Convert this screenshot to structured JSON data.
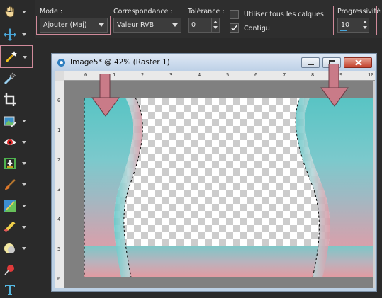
{
  "options": {
    "mode_label": "Mode :",
    "mode_value": "Ajouter (Maj)",
    "match_label": "Correspondance :",
    "match_value": "Valeur RVB",
    "tolerance_label": "Tolérance :",
    "tolerance_value": "0",
    "all_layers_label": "Utiliser tous les calques",
    "all_layers_checked": false,
    "contiguous_label": "Contigu",
    "contiguous_checked": true,
    "feather_label": "Progressivité :",
    "feather_value": "10"
  },
  "tools": [
    {
      "name": "pan-icon",
      "has_menu": true
    },
    {
      "name": "move-icon",
      "has_menu": true
    },
    {
      "name": "magic-wand-icon",
      "has_menu": true,
      "active": true
    },
    {
      "name": "dropper-icon",
      "has_menu": false
    },
    {
      "name": "crop-icon",
      "has_menu": false
    },
    {
      "name": "straighten-icon",
      "has_menu": true
    },
    {
      "name": "red-eye-icon",
      "has_menu": true
    },
    {
      "name": "clone-icon",
      "has_menu": true
    },
    {
      "name": "brush-icon",
      "has_menu": true
    },
    {
      "name": "fill-icon",
      "has_menu": true
    },
    {
      "name": "eraser-icon",
      "has_menu": true
    },
    {
      "name": "dodge-icon",
      "has_menu": true
    },
    {
      "name": "pin-icon",
      "has_menu": false
    },
    {
      "name": "text-icon",
      "has_menu": false
    }
  ],
  "document": {
    "title": "Image5* @  42% (Raster 1)",
    "ruler_top": [
      "0",
      "1",
      "2",
      "3",
      "4",
      "5",
      "6",
      "7",
      "8",
      "9",
      "10"
    ],
    "ruler_left": [
      "0",
      "1",
      "2",
      "3",
      "4",
      "5",
      "6"
    ]
  },
  "colors": {
    "accent": "#d08a9a",
    "arrow": "#c97b88",
    "teal": "#49c2c3",
    "pink": "#e29aa3"
  }
}
